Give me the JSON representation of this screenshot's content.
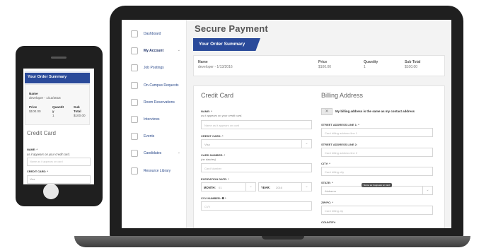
{
  "sidebar": {
    "items": [
      {
        "label": "Dashboard",
        "icon": "grid-icon"
      },
      {
        "label": "My Account",
        "icon": "id-card-icon",
        "active": true,
        "chevron": "⌄"
      },
      {
        "label": "Job Postings",
        "icon": "briefcase-icon"
      },
      {
        "label": "On-Campus Requests",
        "icon": "clipboard-icon"
      },
      {
        "label": "Room Reservations",
        "icon": "door-icon"
      },
      {
        "label": "Interviews",
        "icon": "chat-icon"
      },
      {
        "label": "Events",
        "icon": "people-icon"
      },
      {
        "label": "Candidates",
        "icon": "candidate-icon",
        "chevron": "⌄"
      },
      {
        "label": "Resource Library",
        "icon": "book-icon"
      }
    ]
  },
  "page": {
    "title": "Secure Payment",
    "summary_banner": "Your Order Summary"
  },
  "summary": {
    "name_header": "Name",
    "name_value": "developer - 1/13/2016",
    "price_header": "Price",
    "price_value": "$100.00",
    "quantity_header": "Quantity",
    "quantity_value": "1",
    "subtotal_header": "Sub Total",
    "subtotal_value": "$100.00"
  },
  "credit_card": {
    "title": "Credit Card",
    "name_label": "NAME: *",
    "name_sub": "as it appears on your credit card.",
    "name_placeholder": "Name as it appears on card",
    "card_label": "CREDIT CARD: *",
    "card_value": "Visa",
    "number_label": "CARD NUMBER: *",
    "number_sub": "(no dashes)",
    "number_placeholder": "Card Number",
    "expiration_label": "EXPIRATION DATE: *",
    "month_label": "MONTH:",
    "month_value": "01",
    "year_label": "YEAR:",
    "year_value": "2016",
    "cvv_label": "CVV NUMBER: ❷ *",
    "cvv_placeholder": "CVV"
  },
  "billing": {
    "title": "Billing Address",
    "toggle_symbol": "✕",
    "same_label": "My billing address is the same as my contact address",
    "street1_label": "STREET ADDRESS LINE 1: *",
    "street1_placeholder": "Card billing address line 1",
    "street2_label": "STREET ADDRESS LINE 2:",
    "street2_placeholder": "Card billing address line 2",
    "city_label": "CITY: *",
    "city_placeholder": "Card billing city",
    "state_label": "STATE: *",
    "state_value": "Alabama",
    "state_tooltip": "Name as it appears on card",
    "zip_label": "ZIP/PC: *",
    "zip_placeholder": "Card billing zip",
    "country_label": "COUNTRY:"
  },
  "phone": {
    "banner": "Your Order Summary",
    "name_header": "Name",
    "name_value": "developer - 1/13/2016",
    "price_header": "Price",
    "price_value": "$100.00",
    "quantity_header_1": "Quantit",
    "quantity_header_2": "y",
    "quantity_value": "1",
    "subtotal_header_1": "Sub",
    "subtotal_header_2": "Total",
    "subtotal_value": "$100.00",
    "cc_title": "Credit Card",
    "name_label": "NAME: *",
    "name_sub": "as it appears on your credit card.",
    "name_placeholder": "Name as it appears on card",
    "card_label": "CREDIT CARD: *",
    "card_value": "Visa"
  },
  "colors": {
    "accent": "#2a4a9a",
    "device": "#1f1f1f",
    "nav_text": "#2b4a8b"
  }
}
